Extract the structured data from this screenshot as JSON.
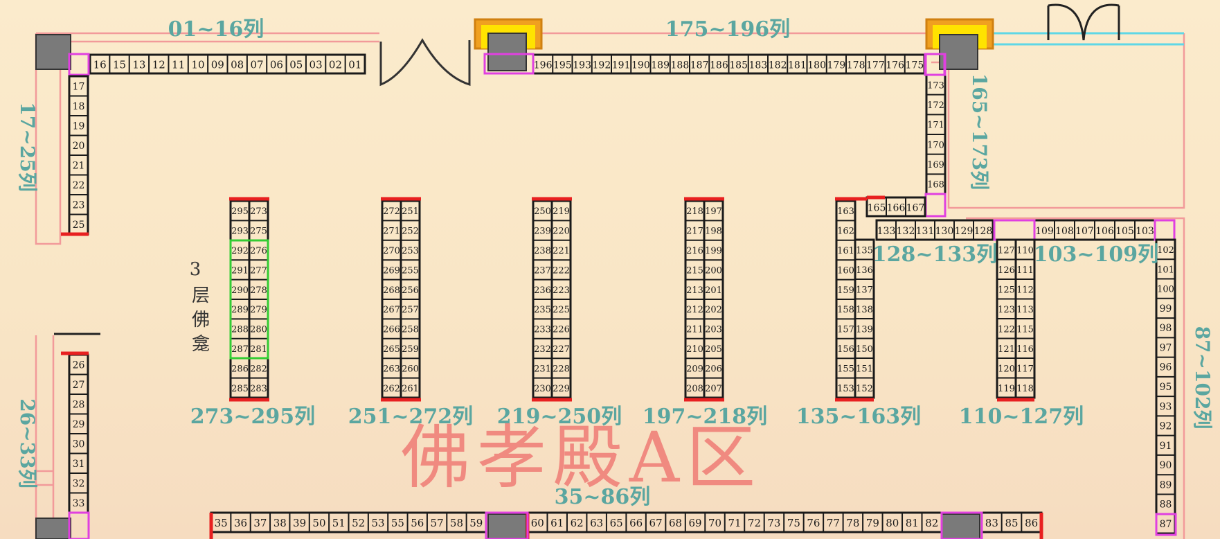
{
  "title": "佛孝殿A区",
  "shrine_note": [
    "3",
    "层",
    "佛",
    "龛"
  ],
  "colors": {
    "background": "#fbebcc",
    "label": "#5aa6a0",
    "title": "#f08a80",
    "wall": "#f29a9a",
    "door": "#5fd7e6",
    "shelf_border": "#1a1a1a",
    "end_red": "#e82020",
    "pillar": "#7a7a7a",
    "magenta": "#e040e0",
    "green": "#33cc33"
  },
  "section_labels": {
    "s01_16": "01~16列",
    "s175_196": "175~196列",
    "s17_25": "17~25列",
    "s165_173": "165~173列",
    "s128_133": "128~133列",
    "s103_109": "103~109列",
    "s87_102": "87~102列",
    "s26_33": "26~33列",
    "s35_86": "35~86列",
    "s273_295": "273~295列",
    "s251_272": "251~272列",
    "s219_250": "219~250列",
    "s197_218": "197~218列",
    "s135_163": "135~163列",
    "s110_127": "110~127列"
  },
  "rows": {
    "top_left": [
      "16",
      "15",
      "13",
      "12",
      "11",
      "10",
      "09",
      "08",
      "07",
      "06",
      "05",
      "03",
      "02",
      "01"
    ],
    "top_right": [
      "196",
      "195",
      "193",
      "192",
      "191",
      "190",
      "189",
      "188",
      "187",
      "186",
      "185",
      "183",
      "182",
      "181",
      "180",
      "179",
      "178",
      "177",
      "176",
      "175"
    ],
    "left_upper": [
      "17",
      "18",
      "19",
      "20",
      "21",
      "22",
      "23",
      "25"
    ],
    "left_lower": [
      "26",
      "27",
      "28",
      "29",
      "30",
      "31",
      "32",
      "33"
    ],
    "right_upper": [
      "173",
      "172",
      "171",
      "170",
      "169",
      "168"
    ],
    "mid_right_a": [
      "165",
      "166",
      "167"
    ],
    "mid_right_b": [
      "133",
      "132",
      "131",
      "130",
      "129",
      "128"
    ],
    "mid_right_c": [
      "109",
      "108",
      "107",
      "106",
      "105",
      "103"
    ],
    "right_col": [
      "102",
      "101",
      "100",
      "99",
      "98",
      "97",
      "96",
      "95",
      "93",
      "92",
      "91",
      "90",
      "89",
      "88",
      "87"
    ],
    "bottom_a": [
      "35",
      "36",
      "37",
      "38",
      "39",
      "50",
      "51",
      "52",
      "53",
      "55",
      "56",
      "57",
      "58",
      "59"
    ],
    "bottom_b": [
      "60",
      "61",
      "62",
      "63",
      "65",
      "66",
      "67",
      "68",
      "69",
      "70",
      "71",
      "72",
      "73",
      "75",
      "76",
      "77",
      "78",
      "79",
      "80",
      "81",
      "82"
    ],
    "bottom_c": [
      "83",
      "85",
      "86"
    ],
    "col_135_left": [
      "163",
      "162",
      "161",
      "160",
      "159",
      "158",
      "157",
      "156",
      "155",
      "153"
    ],
    "col_135_right": [
      "135",
      "136",
      "137",
      "138",
      "139",
      "150",
      "151",
      "152"
    ],
    "col_110_left": [
      "127",
      "126",
      "125",
      "123",
      "122",
      "121",
      "120",
      "119"
    ],
    "col_110_right": [
      "110",
      "111",
      "112",
      "113",
      "115",
      "116",
      "117",
      "118"
    ]
  },
  "double_columns": [
    {
      "left": [
        "295",
        "293",
        "292",
        "291",
        "290",
        "289",
        "288",
        "287",
        "286",
        "285"
      ],
      "right": [
        "273",
        "275",
        "276",
        "277",
        "278",
        "279",
        "280",
        "281",
        "282",
        "283"
      ]
    },
    {
      "left": [
        "272",
        "271",
        "270",
        "269",
        "268",
        "267",
        "266",
        "265",
        "263",
        "262"
      ],
      "right": [
        "251",
        "252",
        "253",
        "255",
        "256",
        "257",
        "258",
        "259",
        "260",
        "261"
      ]
    },
    {
      "left": [
        "250",
        "239",
        "238",
        "237",
        "236",
        "235",
        "233",
        "232",
        "231",
        "230"
      ],
      "right": [
        "219",
        "220",
        "221",
        "222",
        "223",
        "225",
        "226",
        "227",
        "228",
        "229"
      ]
    },
    {
      "left": [
        "218",
        "217",
        "216",
        "215",
        "213",
        "212",
        "211",
        "210",
        "209",
        "208"
      ],
      "right": [
        "197",
        "198",
        "199",
        "200",
        "201",
        "202",
        "203",
        "205",
        "206",
        "207"
      ]
    }
  ]
}
